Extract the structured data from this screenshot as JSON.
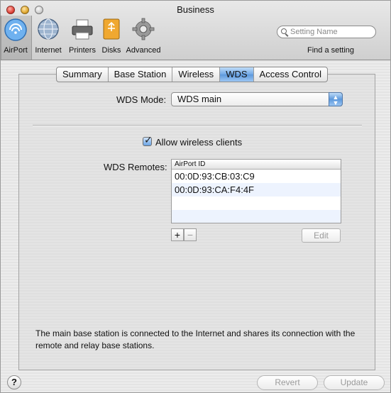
{
  "window": {
    "title": "Business"
  },
  "toolbar": {
    "items": [
      {
        "label": "AirPort",
        "icon": "airport-icon"
      },
      {
        "label": "Internet",
        "icon": "internet-icon"
      },
      {
        "label": "Printers",
        "icon": "printer-icon"
      },
      {
        "label": "Disks",
        "icon": "disk-icon"
      },
      {
        "label": "Advanced",
        "icon": "gear-icon"
      }
    ],
    "search_placeholder": "Setting Name",
    "find_label": "Find a setting"
  },
  "tabs": [
    "Summary",
    "Base Station",
    "Wireless",
    "WDS",
    "Access Control"
  ],
  "selected_tab": "WDS",
  "wds": {
    "mode_label": "WDS Mode:",
    "mode_value": "WDS main",
    "allow_clients_label": "Allow wireless clients",
    "allow_clients_checked": true,
    "remotes_label": "WDS Remotes:",
    "table_header": "AirPort ID",
    "remotes": [
      "00:0D:93:CB:03:C9",
      "00:0D:93:CA:F4:4F"
    ],
    "add_label": "+",
    "remove_label": "−",
    "edit_label": "Edit",
    "description": "The main base station is connected to the Internet and shares its connection with the remote and relay base stations."
  },
  "footer": {
    "help_label": "?",
    "revert_label": "Revert",
    "update_label": "Update"
  },
  "colors": {
    "accent": "#5d98dc",
    "selected_row": "#edf3fe"
  }
}
